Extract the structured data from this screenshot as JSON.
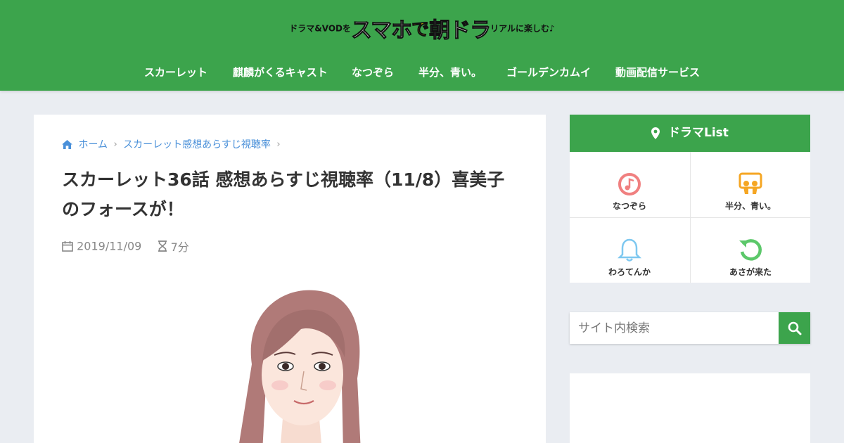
{
  "site": {
    "logo_prefix": "ドラマ&VODを",
    "logo_main": "スマホ",
    "logo_de": "で",
    "logo_main2": "朝ドラ",
    "logo_suffix": "リアルに楽しむ♪"
  },
  "nav": {
    "items": [
      {
        "label": "スカーレット"
      },
      {
        "label": "麒麟がくるキャスト"
      },
      {
        "label": "なつぞら"
      },
      {
        "label": "半分、青い。"
      },
      {
        "label": "ゴールデンカムイ"
      },
      {
        "label": "動画配信サービス"
      }
    ]
  },
  "breadcrumb": {
    "home": "ホーム",
    "category": "スカーレット感想あらすじ視聴率"
  },
  "article": {
    "title": "スカーレット36話 感想あらすじ視聴率（11/8）喜美子のフォースが！",
    "date": "2019/11/09",
    "read_time": "7分"
  },
  "sidebar": {
    "widget_title": "ドラマList",
    "items": [
      {
        "label": "なつぞら",
        "icon": "music-note-icon",
        "color": "#f08080"
      },
      {
        "label": "半分、青い。",
        "icon": "slideshare-icon",
        "color": "#f5a623"
      },
      {
        "label": "わろてんか",
        "icon": "bell-icon",
        "color": "#7ec8f0"
      },
      {
        "label": "あさが来た",
        "icon": "refresh-icon",
        "color": "#5cc86a"
      }
    ]
  },
  "search": {
    "placeholder": "サイト内検索"
  },
  "colors": {
    "brand_green": "#3ca44c",
    "link_blue": "#4a90d9",
    "background": "#eaedf2"
  }
}
